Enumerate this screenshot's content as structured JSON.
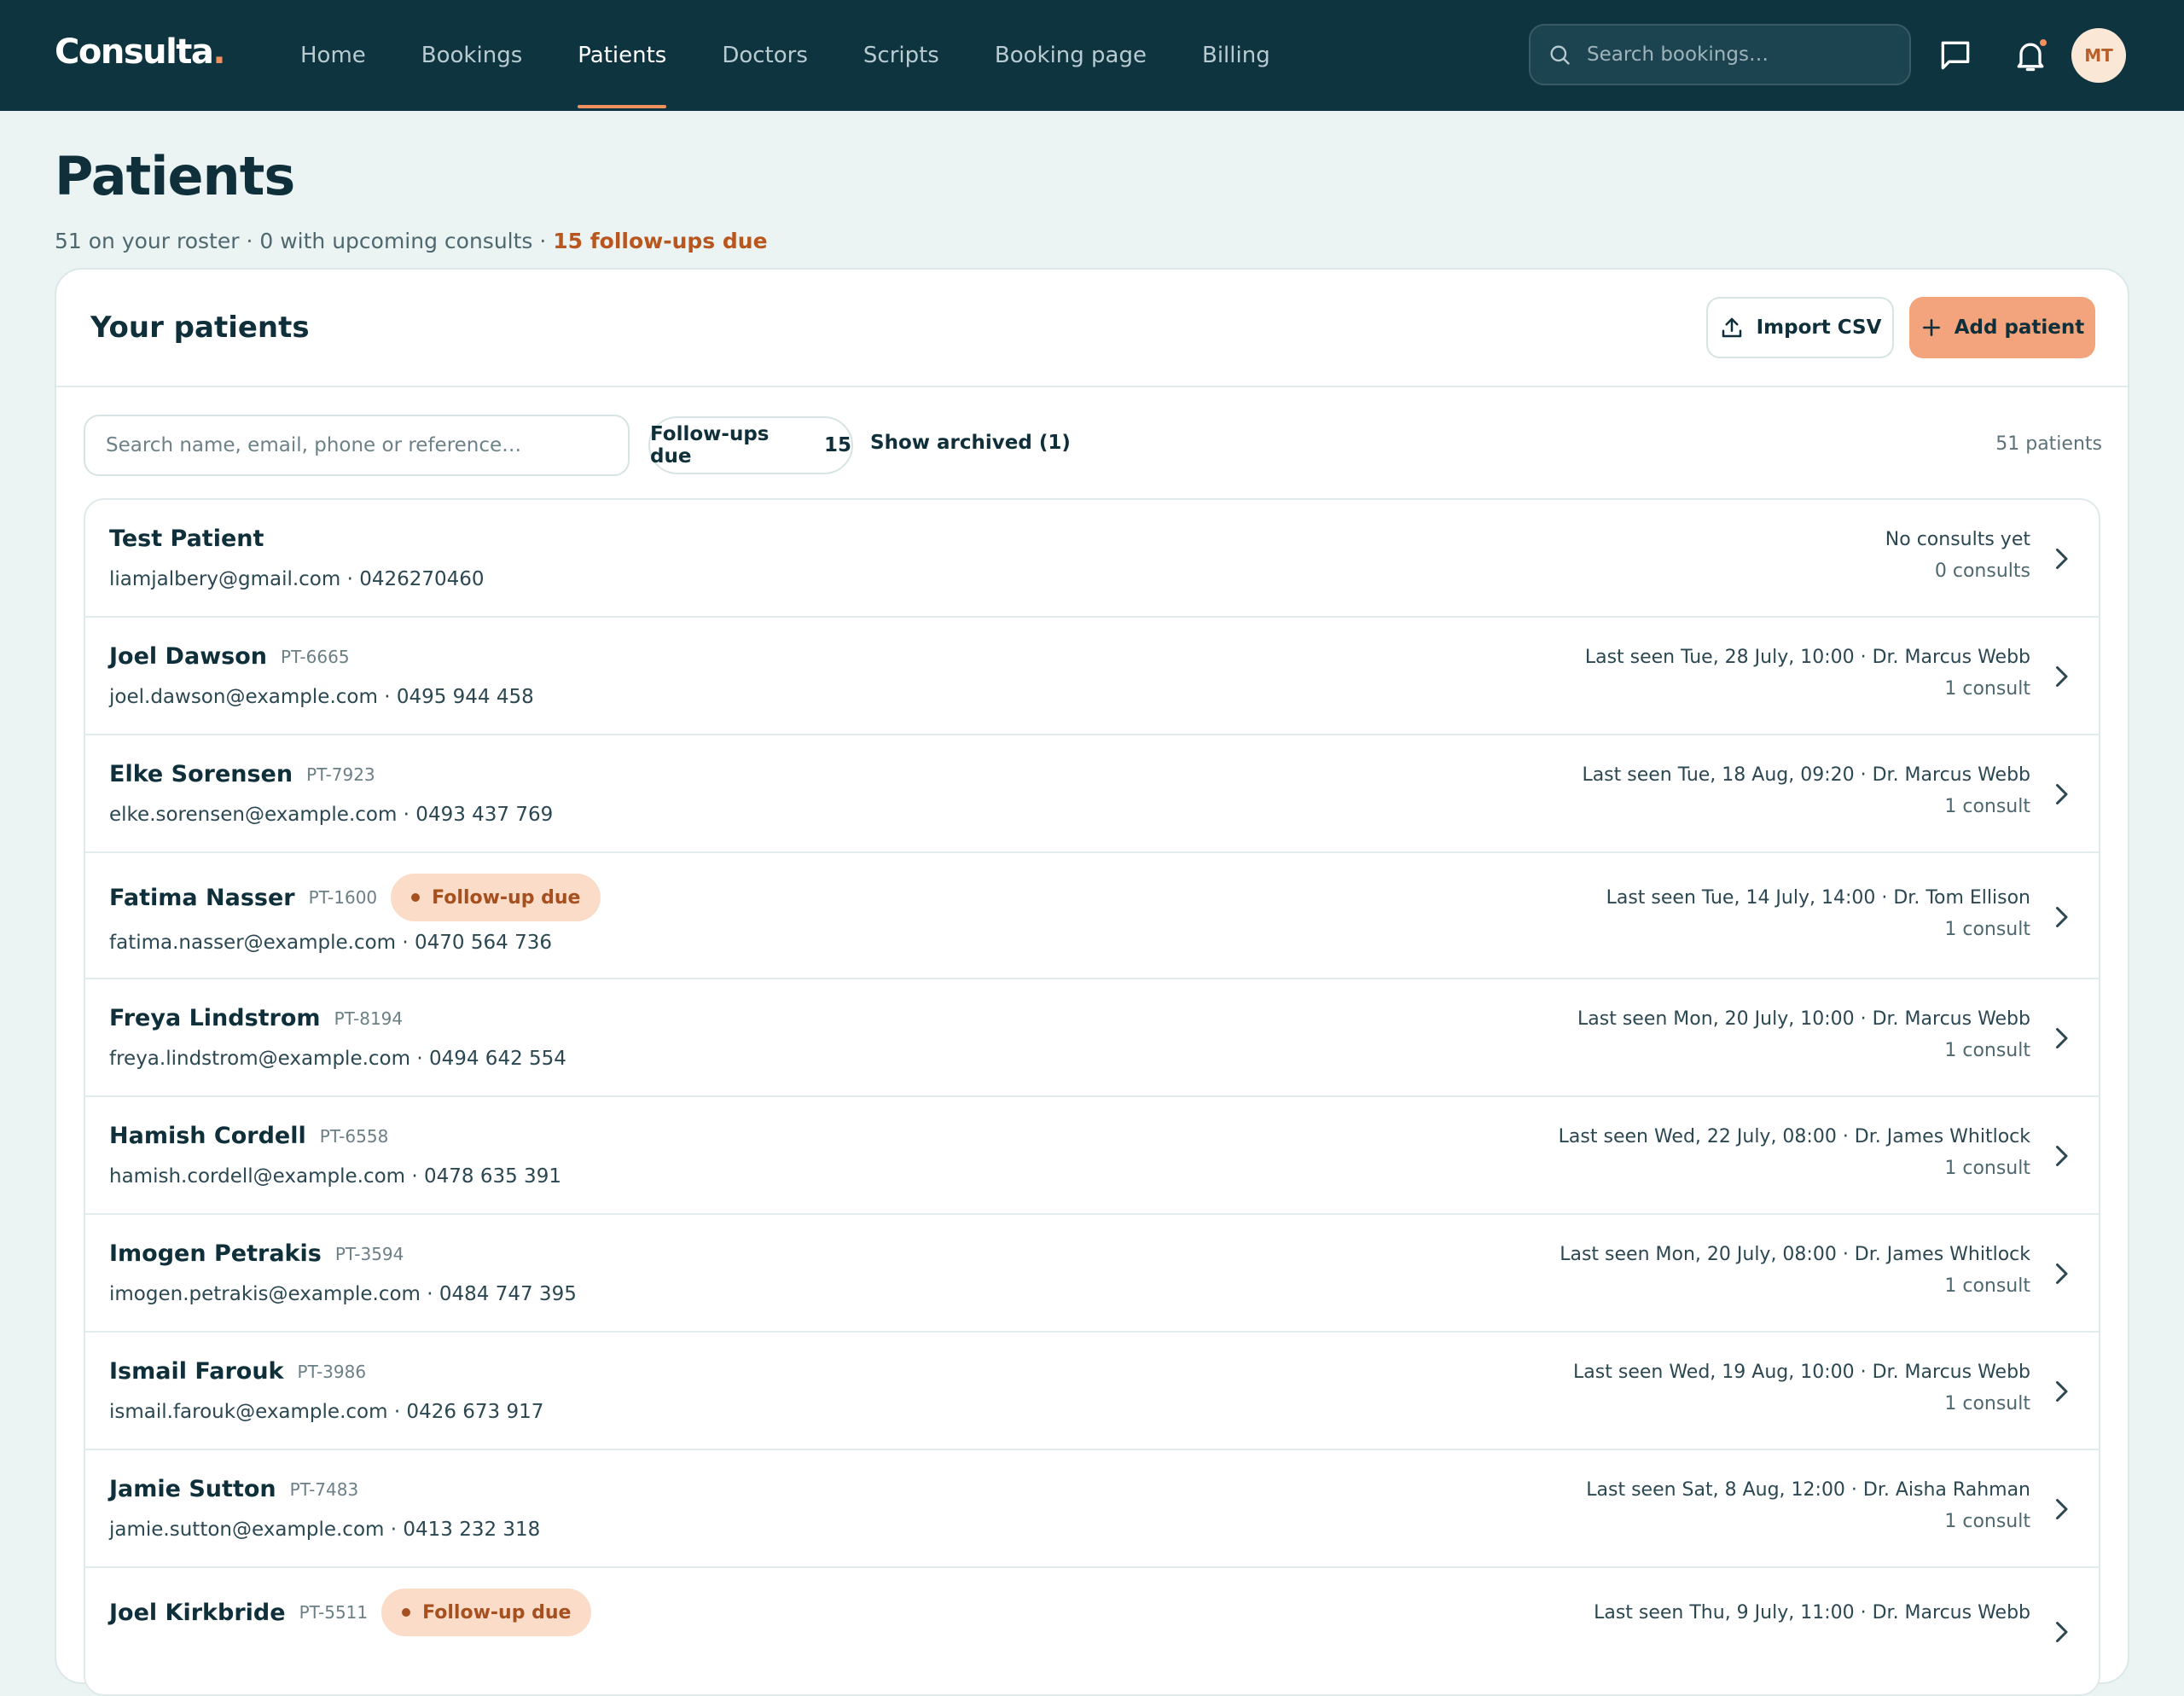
{
  "app": {
    "logo": "Consulta",
    "logo_dot": "."
  },
  "nav": {
    "items": [
      {
        "label": "Home",
        "active": false
      },
      {
        "label": "Bookings",
        "active": false
      },
      {
        "label": "Patients",
        "active": true
      },
      {
        "label": "Doctors",
        "active": false
      },
      {
        "label": "Scripts",
        "active": false
      },
      {
        "label": "Booking page",
        "active": false
      },
      {
        "label": "Billing",
        "active": false
      }
    ],
    "search_placeholder": "Search bookings…",
    "avatar_initials": "MT"
  },
  "page": {
    "title": "Patients",
    "subtitle": "51 on your roster · 0 with upcoming consults · ",
    "subtitle_due": "15 follow-ups due"
  },
  "card": {
    "title": "Your patients",
    "import_label": "Import CSV",
    "add_label": "Add patient",
    "search_placeholder": "Search name, email, phone or reference…",
    "followups_label": "Follow-ups due",
    "followups_count": "15",
    "show_archived": "Show archived (1)",
    "patient_count": "51 patients"
  },
  "patients": [
    {
      "name": "Test Patient",
      "ref": "",
      "followup": false,
      "contact": "liamjalbery@gmail.com · 0426270460",
      "last": "No consults yet",
      "consults": "0 consults"
    },
    {
      "name": "Joel Dawson",
      "ref": "PT-6665",
      "followup": false,
      "contact": "joel.dawson@example.com · 0495 944 458",
      "last": "Last seen Tue, 28 July, 10:00 · Dr. Marcus Webb",
      "consults": "1 consult"
    },
    {
      "name": "Elke Sorensen",
      "ref": "PT-7923",
      "followup": false,
      "contact": "elke.sorensen@example.com · 0493 437 769",
      "last": "Last seen Tue, 18 Aug, 09:20 · Dr. Marcus Webb",
      "consults": "1 consult"
    },
    {
      "name": "Fatima Nasser",
      "ref": "PT-1600",
      "followup": true,
      "contact": "fatima.nasser@example.com · 0470 564 736",
      "last": "Last seen Tue, 14 July, 14:00 · Dr. Tom Ellison",
      "consults": "1 consult"
    },
    {
      "name": "Freya Lindstrom",
      "ref": "PT-8194",
      "followup": false,
      "contact": "freya.lindstrom@example.com · 0494 642 554",
      "last": "Last seen Mon, 20 July, 10:00 · Dr. Marcus Webb",
      "consults": "1 consult"
    },
    {
      "name": "Hamish Cordell",
      "ref": "PT-6558",
      "followup": false,
      "contact": "hamish.cordell@example.com · 0478 635 391",
      "last": "Last seen Wed, 22 July, 08:00 · Dr. James Whitlock",
      "consults": "1 consult"
    },
    {
      "name": "Imogen Petrakis",
      "ref": "PT-3594",
      "followup": false,
      "contact": "imogen.petrakis@example.com · 0484 747 395",
      "last": "Last seen Mon, 20 July, 08:00 · Dr. James Whitlock",
      "consults": "1 consult"
    },
    {
      "name": "Ismail Farouk",
      "ref": "PT-3986",
      "followup": false,
      "contact": "ismail.farouk@example.com · 0426 673 917",
      "last": "Last seen Wed, 19 Aug, 10:00 · Dr. Marcus Webb",
      "consults": "1 consult"
    },
    {
      "name": "Jamie Sutton",
      "ref": "PT-7483",
      "followup": false,
      "contact": "jamie.sutton@example.com · 0413 232 318",
      "last": "Last seen Sat, 8 Aug, 12:00 · Dr. Aisha Rahman",
      "consults": "1 consult"
    },
    {
      "name": "Joel Kirkbride",
      "ref": "PT-5511",
      "followup": true,
      "contact": "",
      "last": "Last seen Thu, 9 July, 11:00 · Dr. Marcus Webb",
      "consults": ""
    }
  ],
  "followup_badge_label": "Follow-up due",
  "colors": {
    "nav_bg": "#0e3440",
    "accent": "#f0905f",
    "add_button": "#f3a47c",
    "badge_bg": "#fbdcc8",
    "badge_text": "#a5501e"
  }
}
